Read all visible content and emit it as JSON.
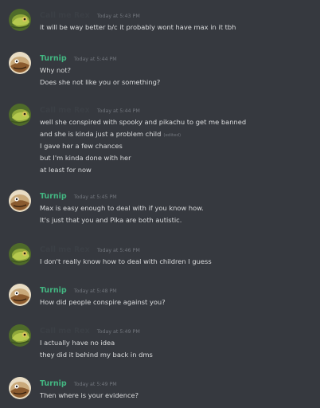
{
  "messages": [
    {
      "author": "Call me Rex",
      "author_color": "#3b3f45",
      "avatar": "chameleon-avatar",
      "timestamp": "Today at 5:43 PM",
      "lines": [
        "it will be way better b/c it probably wont have max in it tbh"
      ]
    },
    {
      "author": "Turnip",
      "author_color": "#43b581",
      "avatar": "turnip-avatar",
      "timestamp": "Today at 5:44 PM",
      "lines": [
        "Why not?",
        "Does she not like you or something?"
      ]
    },
    {
      "author": "Call me Rex",
      "author_color": "#3b3f45",
      "avatar": "chameleon-avatar",
      "timestamp": "Today at 5:44 PM",
      "lines": [
        "well she conspired with spooky and pikachu to get me banned",
        "and she is kinda just a problem child",
        "I gave her a few chances",
        "but I'm kinda done with her",
        "at least for now"
      ],
      "edited_label": "(edited)"
    },
    {
      "author": "Turnip",
      "author_color": "#43b581",
      "avatar": "turnip-avatar",
      "timestamp": "Today at 5:45 PM",
      "lines": [
        "Max is easy enough to deal with if you know how.",
        "It's just that you and Pika are both autistic."
      ]
    },
    {
      "author": "Call me Rex",
      "author_color": "#3b3f45",
      "avatar": "chameleon-avatar",
      "timestamp": "Today at 5:46 PM",
      "lines": [
        "I don't really know how to deal with children I guess"
      ]
    },
    {
      "author": "Turnip",
      "author_color": "#43b581",
      "avatar": "turnip-avatar",
      "timestamp": "Today at 5:48 PM",
      "lines": [
        "How did people conspire against you?"
      ]
    },
    {
      "author": "Call me Rex",
      "author_color": "#3b3f45",
      "avatar": "chameleon-avatar",
      "timestamp": "Today at 5:49 PM",
      "lines": [
        "I actually have no idea",
        "they did it behind my back in dms"
      ]
    },
    {
      "author": "Turnip",
      "author_color": "#43b581",
      "avatar": "turnip-avatar",
      "timestamp": "Today at 5:49 PM",
      "lines": [
        "Then where is your evidence?"
      ]
    }
  ]
}
